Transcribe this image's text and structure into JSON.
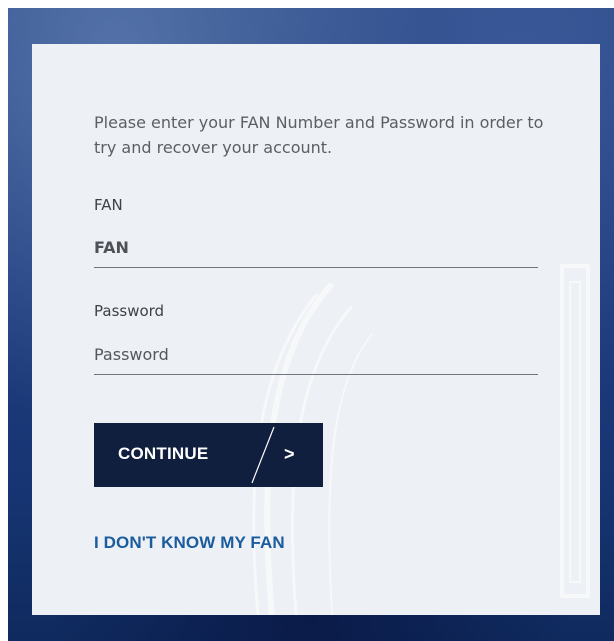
{
  "recovery_form": {
    "intro_text": "Please enter your FAN Number and Password in order to try and recover your account.",
    "fan": {
      "label": "FAN",
      "value": "",
      "placeholder": "FAN"
    },
    "password": {
      "label": "Password",
      "value": "",
      "placeholder": "Password"
    },
    "continue_button": {
      "label": "CONTINUE",
      "arrow": ">"
    },
    "dont_know_fan_link": "I DON'T KNOW MY FAN"
  },
  "colors": {
    "card_background": "#edf0f4",
    "button_background": "#0f1f3d",
    "link": "#1a5c9e",
    "page_background": "#203e7e"
  }
}
